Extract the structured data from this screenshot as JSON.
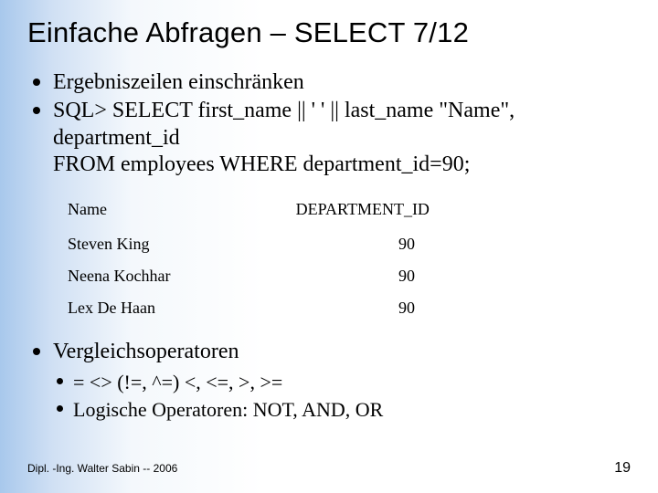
{
  "title": "Einfache Abfragen – SELECT 7/12",
  "bullets": {
    "b1": "Ergebniszeilen einschränken",
    "b2_l1": "SQL> SELECT first_name || ' ' || last_name \"Name\",",
    "b2_l2": "department_id",
    "b2_l3": "FROM employees WHERE department_id=90;",
    "b3": "Vergleichsoperatoren"
  },
  "table": {
    "headers": {
      "name": "Name",
      "dept": "DEPARTMENT_ID"
    },
    "rows": [
      {
        "name": "Steven King",
        "dept": "90"
      },
      {
        "name": "Neena Kochhar",
        "dept": "90"
      },
      {
        "name": "Lex De Haan",
        "dept": "90"
      }
    ]
  },
  "sub": {
    "s1": "=   <> (!=, ^=)   <, <=, >, >=",
    "s2": "Logische Operatoren: NOT, AND, OR"
  },
  "footer": {
    "left": "Dipl. -Ing. Walter Sabin  --  2006",
    "right": "19"
  }
}
